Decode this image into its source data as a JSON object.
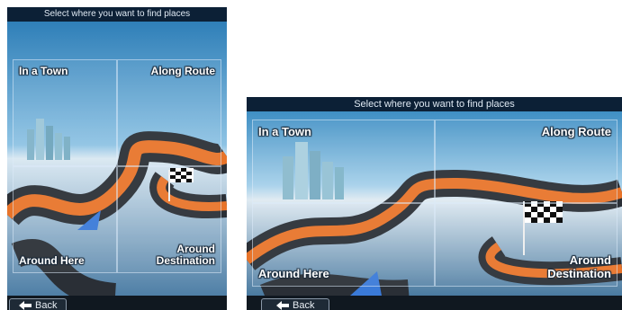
{
  "portrait": {
    "header": "Select where you want to find places",
    "tiles": {
      "in_a_town": "In a Town",
      "along_route": "Along Route",
      "around_here": "Around Here",
      "around_destination_1": "Around",
      "around_destination_2": "Destination"
    },
    "back": "Back"
  },
  "landscape": {
    "header": "Select where you want to find places",
    "tiles": {
      "in_a_town": "In a Town",
      "along_route": "Along Route",
      "around_here": "Around Here",
      "around_destination_1": "Around",
      "around_destination_2": "Destination"
    },
    "back": "Back"
  },
  "icons": [
    "city-icon",
    "flag-icon",
    "position-arrow-icon",
    "back-arrow-icon"
  ],
  "colors": {
    "road": "#e8742a",
    "sky": "#3f8fc4",
    "bar": "#0c2036"
  }
}
